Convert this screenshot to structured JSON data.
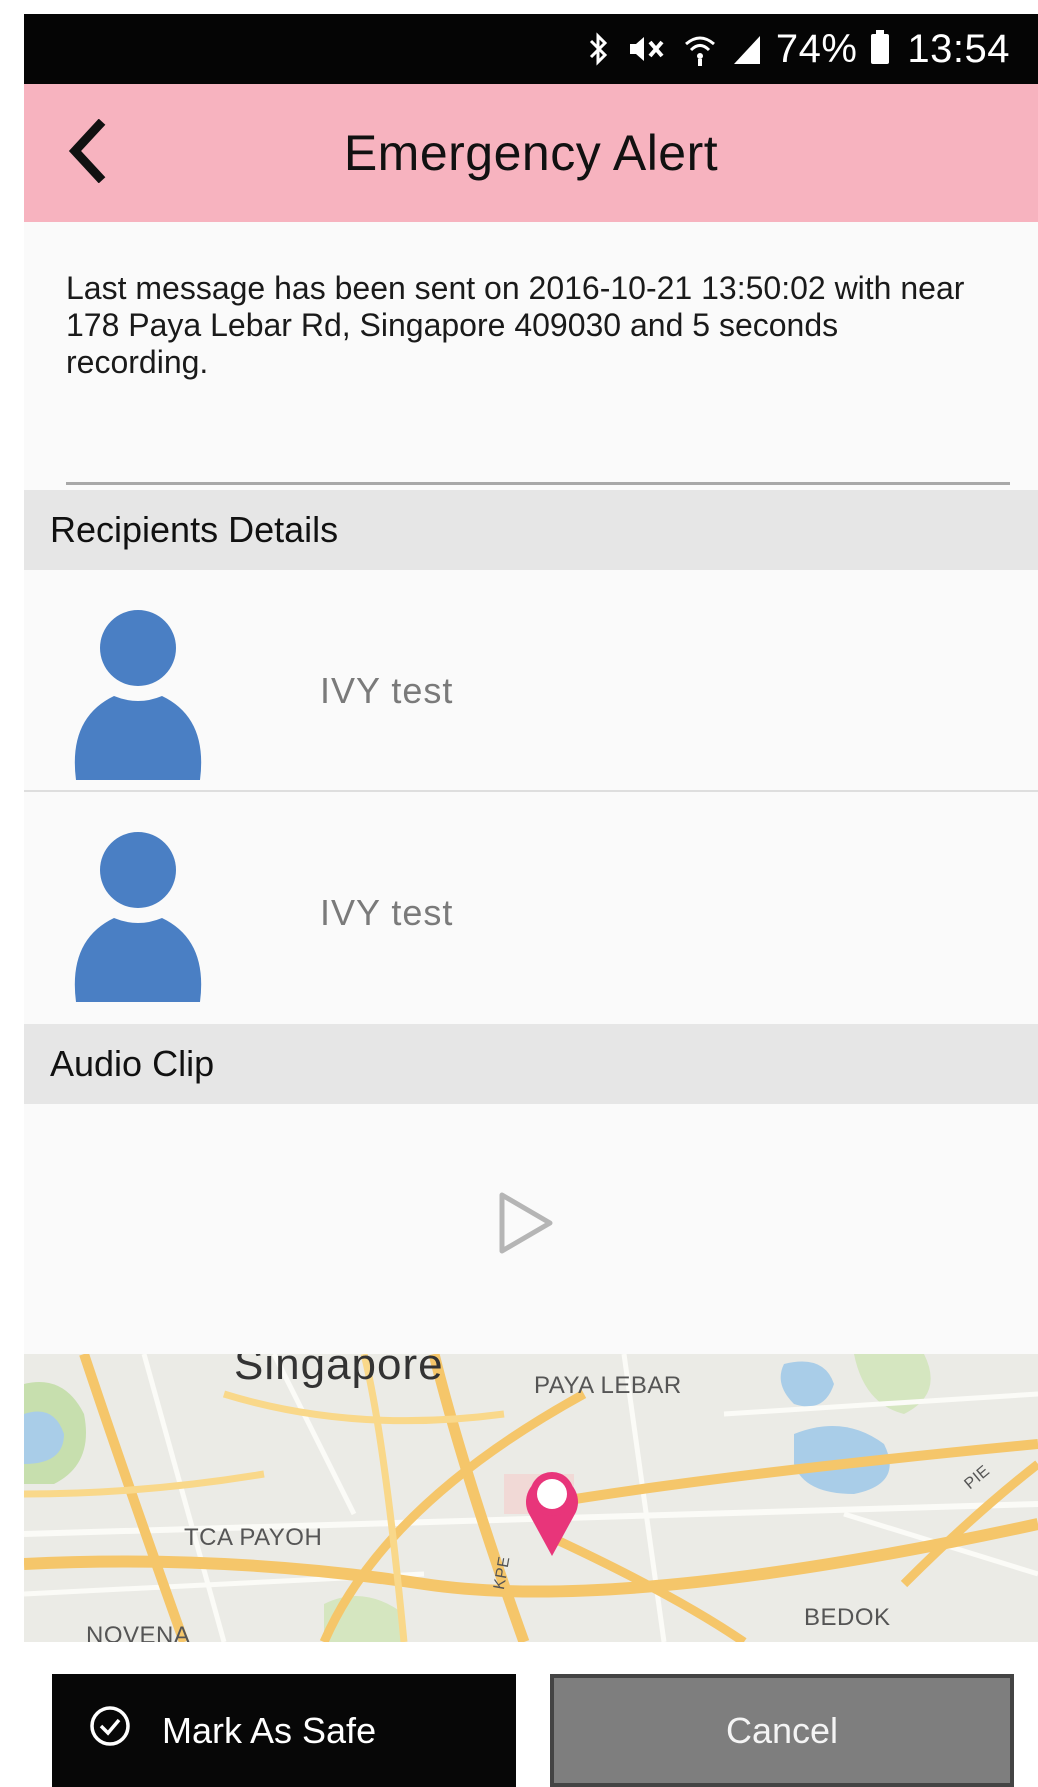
{
  "status_bar": {
    "battery_percent": "74%",
    "time": "13:54",
    "icons": [
      "bluetooth-icon",
      "mute-icon",
      "wifi-icon",
      "signal-icon",
      "battery-icon"
    ]
  },
  "header": {
    "title": "Emergency Alert",
    "back_icon": "chevron-left-icon",
    "background": "#f7b3bf"
  },
  "message": {
    "text": "Last message has been sent on 2016-10-21 13:50:02 with near 178 Paya Lebar Rd, Singapore 409030 and 5 seconds recording."
  },
  "recipients": {
    "title": "Recipients Details",
    "items": [
      {
        "name": "IVY test",
        "avatar_color": "#4a7fc4"
      },
      {
        "name": "IVY test",
        "avatar_color": "#4a7fc4"
      }
    ]
  },
  "audio": {
    "title": "Audio Clip",
    "play_icon": "play-icon"
  },
  "map": {
    "labels": {
      "city": "Singapore",
      "paya_lebar": "PAYA LEBAR",
      "tca_payoh": "TCA PAYOH",
      "novena": "NOVENA",
      "bedok": "BEDOK",
      "kpe": "KPE",
      "pie": "PIE"
    },
    "pin_color": "#e8357a"
  },
  "actions": {
    "safe_label": "Mark As Safe",
    "cancel_label": "Cancel"
  }
}
